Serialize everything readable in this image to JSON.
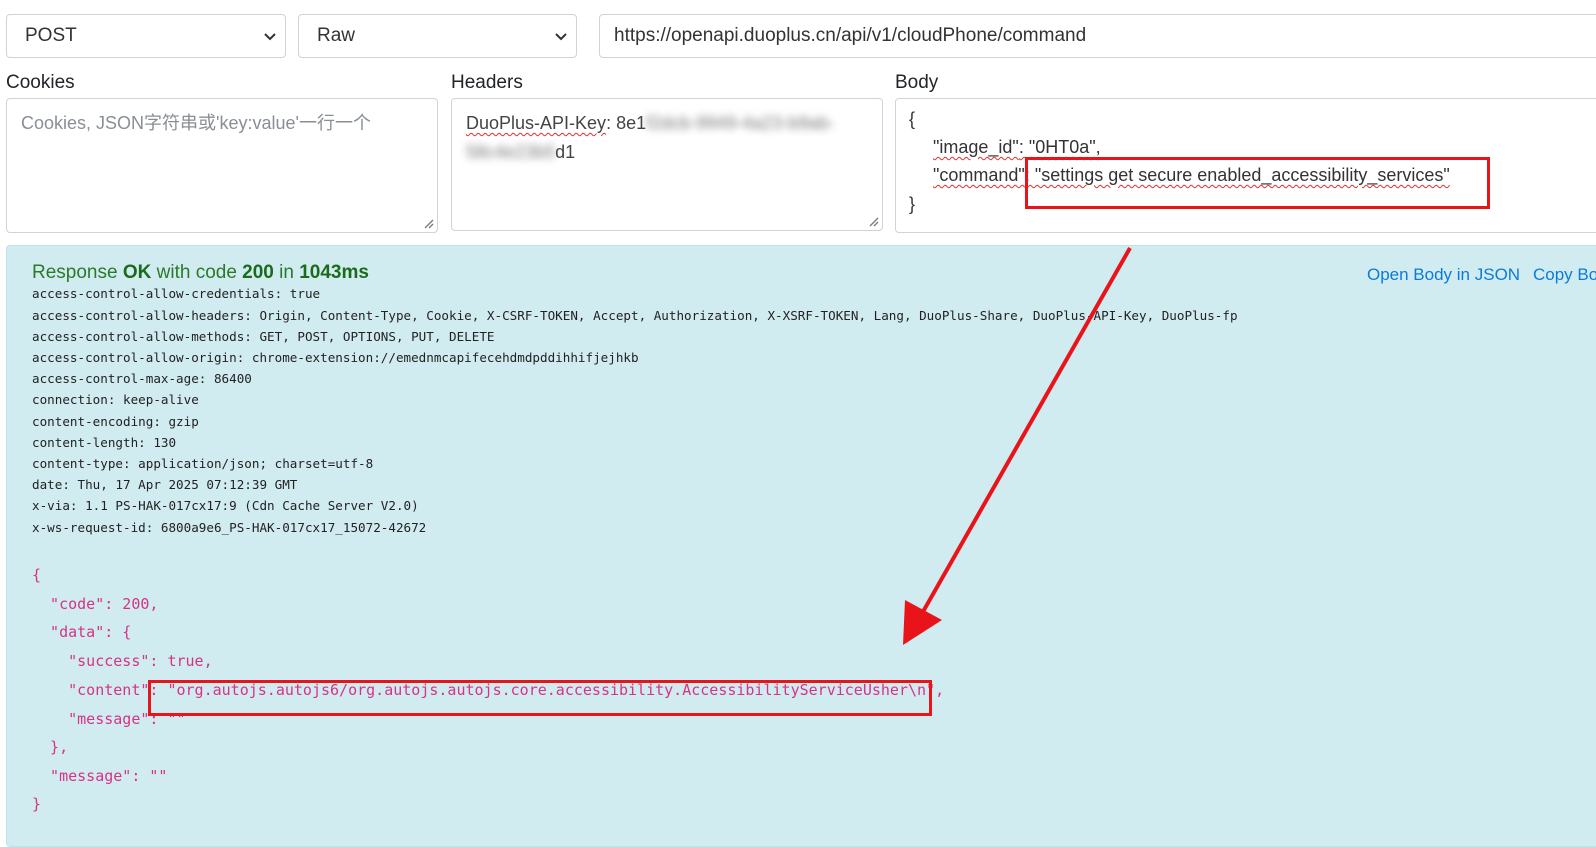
{
  "request": {
    "method": "POST",
    "body_type": "Raw",
    "url": "https://openapi.duoplus.cn/api/v1/cloudPhone/command"
  },
  "cookies": {
    "label": "Cookies",
    "placeholder": "Cookies, JSON字符串或'key:value'一行一个"
  },
  "headers": {
    "label": "Headers",
    "key": "DuoPlus-API-Key",
    "value_prefix": ": 8e1",
    "value_blurred_1": "f2dcb-9949-4a23-b9ab-",
    "value_blurred_2": "58c4e23b5",
    "value_suffix": "d1"
  },
  "body": {
    "label": "Body",
    "open_brace": "{",
    "image_id_key": "\"image_id\"",
    "image_id_value": ": \"0HT0a\",",
    "command_key": "\"command\"",
    "command_value": ": \"settings get secure enabled_accessibility_services\"",
    "close_brace": "}"
  },
  "response": {
    "prefix": "Response ",
    "status_word": "OK",
    "mid": " with code ",
    "code": "200",
    "in_word": " in ",
    "time": "1043ms",
    "link_open_json": "Open Body in JSON",
    "link_copy_body": "Copy Body",
    "headers": [
      "access-control-allow-credentials: true",
      "access-control-allow-headers: Origin, Content-Type, Cookie, X-CSRF-TOKEN, Accept, Authorization, X-XSRF-TOKEN, Lang, DuoPlus-Share, DuoPlus-API-Key, DuoPlus-fp",
      "access-control-allow-methods: GET, POST, OPTIONS, PUT, DELETE",
      "access-control-allow-origin: chrome-extension://emednmcapifecehdmdpddihhifjejhkb",
      "access-control-max-age: 86400",
      "connection: keep-alive",
      "content-encoding: gzip",
      "content-length: 130",
      "content-type: application/json; charset=utf-8",
      "date: Thu, 17 Apr 2025 07:12:39 GMT",
      "x-via: 1.1 PS-HAK-017cx17:9 (Cdn Cache Server V2.0)",
      "x-ws-request-id: 6800a9e6_PS-HAK-017cx17_15072-42672"
    ],
    "json_lines": [
      "{",
      "  \"code\": 200,",
      "  \"data\": {",
      "    \"success\": true,",
      "    \"content\": \"org.autojs.autojs6/org.autojs.autojs.core.accessibility.AccessibilityServiceUsher\\n\",",
      "    \"message\": \"\"",
      "  },",
      "  \"message\": \"\"",
      "}"
    ]
  },
  "colors": {
    "response_bg": "#d1ecf1",
    "status_green": "#2a7a2a",
    "link_blue": "#0b7bd6",
    "json_pink": "#d63384",
    "annotation_red": "#e8141a"
  }
}
